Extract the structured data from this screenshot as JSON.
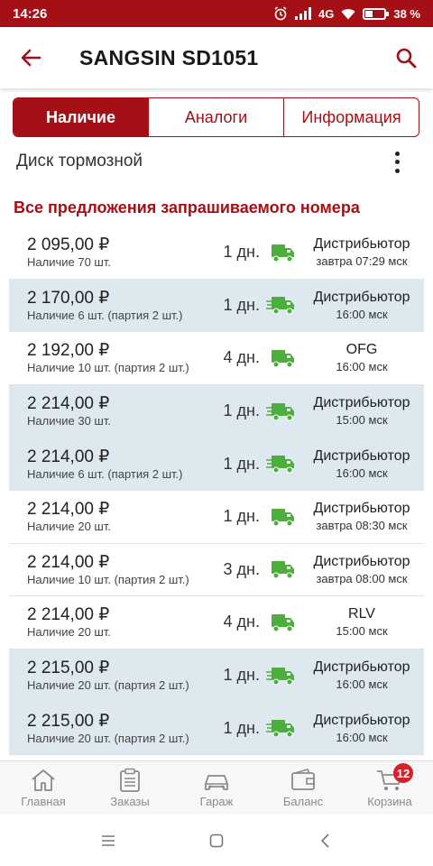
{
  "status_bar": {
    "time": "14:26",
    "network": "4G",
    "battery_text": "38 %",
    "battery_level": 0.38
  },
  "header": {
    "title": "SANGSIN SD1051",
    "back_icon": "arrow-left-icon",
    "search_icon": "search-icon"
  },
  "tabs": [
    {
      "label": "Наличие",
      "active": true
    },
    {
      "label": "Аналоги",
      "active": false
    },
    {
      "label": "Информация",
      "active": false
    }
  ],
  "subtitle": "Диск тормозной",
  "section_title": "Все предложения запрашиваемого номера",
  "offers": [
    {
      "price": "2 095,00 ₽",
      "stock": "Наличие 70 шт.",
      "days": "1 дн.",
      "truck": "static",
      "supplier": "Дистрибьютор",
      "time": "завтра 07:29 мск",
      "bg": "white"
    },
    {
      "price": "2 170,00 ₽",
      "stock": "Наличие 6 шт. (партия 2 шт.)",
      "days": "1 дн.",
      "truck": "fast",
      "supplier": "Дистрибьютор",
      "time": "16:00 мск",
      "bg": "blue"
    },
    {
      "price": "2 192,00 ₽",
      "stock": "Наличие 10 шт. (партия 2 шт.)",
      "days": "4 дн.",
      "truck": "static",
      "supplier": "OFG",
      "time": "16:00 мск",
      "bg": "white"
    },
    {
      "price": "2 214,00 ₽",
      "stock": "Наличие 30 шт.",
      "days": "1 дн.",
      "truck": "fast",
      "supplier": "Дистрибьютор",
      "time": "15:00 мск",
      "bg": "blue"
    },
    {
      "price": "2 214,00 ₽",
      "stock": "Наличие 6 шт. (партия 2 шт.)",
      "days": "1 дн.",
      "truck": "fast",
      "supplier": "Дистрибьютор",
      "time": "16:00 мск",
      "bg": "blue"
    },
    {
      "price": "2 214,00 ₽",
      "stock": "Наличие 20 шт.",
      "days": "1 дн.",
      "truck": "static",
      "supplier": "Дистрибьютор",
      "time": "завтра 08:30 мск",
      "bg": "white"
    },
    {
      "price": "2 214,00 ₽",
      "stock": "Наличие 10 шт. (партия 2 шт.)",
      "days": "3 дн.",
      "truck": "static",
      "supplier": "Дистрибьютор",
      "time": "завтра 08:00 мск",
      "bg": "white"
    },
    {
      "price": "2 214,00 ₽",
      "stock": "Наличие 20 шт.",
      "days": "4 дн.",
      "truck": "static",
      "supplier": "RLV",
      "time": "15:00 мск",
      "bg": "white"
    },
    {
      "price": "2 215,00 ₽",
      "stock": "Наличие 20 шт. (партия 2 шт.)",
      "days": "1 дн.",
      "truck": "fast",
      "supplier": "Дистрибьютор",
      "time": "16:00 мск",
      "bg": "blue"
    },
    {
      "price": "2 215,00 ₽",
      "stock": "Наличие 20 шт. (партия 2 шт.)",
      "days": "1 дн.",
      "truck": "fast",
      "supplier": "Дистрибьютор",
      "time": "16:00 мск",
      "bg": "blue"
    }
  ],
  "bottom_nav": [
    {
      "label": "Главная",
      "icon": "home-icon"
    },
    {
      "label": "Заказы",
      "icon": "orders-icon"
    },
    {
      "label": "Гараж",
      "icon": "car-icon"
    },
    {
      "label": "Баланс",
      "icon": "wallet-icon"
    },
    {
      "label": "Корзина",
      "icon": "cart-icon",
      "badge": "12"
    }
  ],
  "colors": {
    "brand": "#a50f16",
    "row_highlight": "#dde8ef",
    "truck_green": "#4caf3b",
    "badge_red": "#d3222a"
  }
}
